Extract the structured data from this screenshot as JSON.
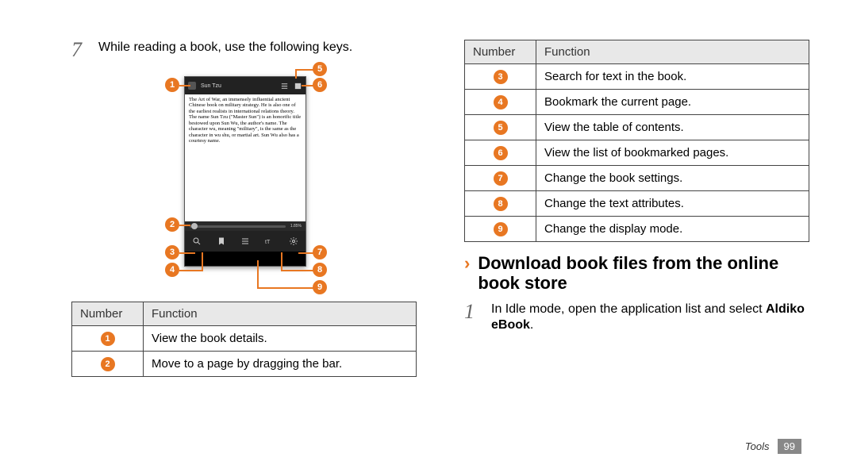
{
  "step7": {
    "number": "7",
    "text": "While reading a book, use the following keys."
  },
  "reader_text": "The Art of War, an immensely influential ancient Chinese book on military strategy. He is also one of the earliest realists in international relations theory.   The name Sun Tzu (\"Master Sun\") is an honorific title bestowed upon Sun Wu, the author's name. The character wu, meaning \"military\", is the same as the character in wu shu, or martial art. Sun Wu also has a courtesy name.",
  "progress_pct": "1.85%",
  "table_headers": {
    "number": "Number",
    "function": "Function"
  },
  "table1": [
    {
      "n": "1",
      "f": "View the book details."
    },
    {
      "n": "2",
      "f": "Move to a page by dragging the bar."
    }
  ],
  "table2": [
    {
      "n": "3",
      "f": "Search for text in the book."
    },
    {
      "n": "4",
      "f": "Bookmark the current page."
    },
    {
      "n": "5",
      "f": "View the table of contents."
    },
    {
      "n": "6",
      "f": "View the list of bookmarked pages."
    },
    {
      "n": "7",
      "f": "Change the book settings."
    },
    {
      "n": "8",
      "f": "Change the text attributes."
    },
    {
      "n": "9",
      "f": "Change the display mode."
    }
  ],
  "heading2": "Download book files from the online book store",
  "step1": {
    "number": "1",
    "prefix": "In Idle mode, open the application list and select ",
    "bold": "Aldiko eBook",
    "suffix": "."
  },
  "footer": {
    "section": "Tools",
    "page": "99"
  }
}
